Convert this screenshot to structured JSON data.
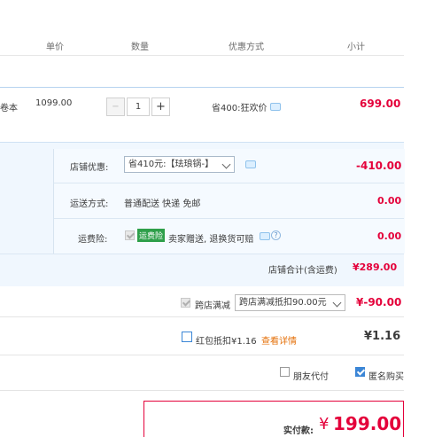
{
  "header": {
    "unit_price": "单价",
    "quantity": "数量",
    "promotion": "优惠方式",
    "subtotal": "小计"
  },
  "item": {
    "name_tail": "卷本",
    "unit_price": "1099.00",
    "minus": "−",
    "qty": "1",
    "plus": "+",
    "promo": "省400:狂欢价",
    "subtotal": "699.00"
  },
  "shop": {
    "discount_label": "店铺优惠:",
    "discount_select": "省410元:【珐琅锅-】",
    "discount_value": "-410.00",
    "shipping_label": "运送方式:",
    "shipping_text": "普通配送 快递 免邮",
    "shipping_value": "0.00",
    "insurance_label": "运费险:",
    "insurance_badge": "运费险",
    "insurance_text": "卖家赠送, 退换货可赔",
    "insurance_value": "0.00",
    "total_label": "店铺合计(含运费)",
    "total_value": "¥289.00"
  },
  "cross": {
    "label": "跨店满减",
    "select": "跨店满减抵扣90.00元",
    "value": "¥-90.00"
  },
  "redpack": {
    "label": "红包抵扣¥1.16",
    "link": "查看详情",
    "value": "¥1.16"
  },
  "options": {
    "friend_pay": "朋友代付",
    "anonymous": "匿名购买"
  },
  "pay": {
    "label": "实付款:",
    "currency": "¥",
    "amount": "199.00"
  },
  "colors": {
    "accent_red": "#e4003a",
    "link_orange": "#e4700a",
    "checkbox_blue": "#3b86d6",
    "badge_green": "#2e9f4a"
  }
}
